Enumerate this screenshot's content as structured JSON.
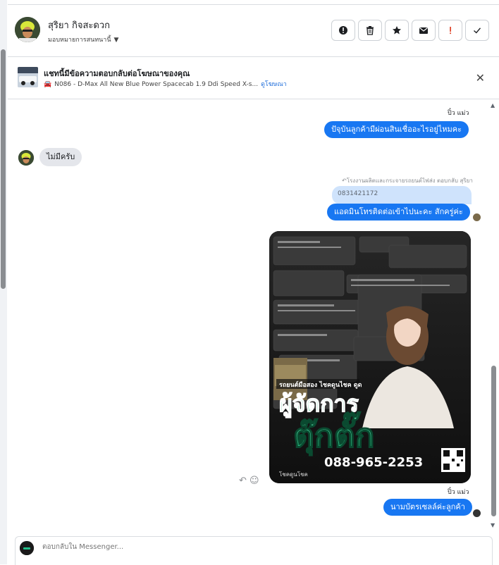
{
  "header": {
    "contact_name": "สุริยา กิจสะดวก",
    "assign_label": "มอบหมายการสนทนานี้",
    "action_icons": [
      "alert-circle-icon",
      "trash-icon",
      "star-icon",
      "envelope-icon",
      "exclamation-icon",
      "check-icon"
    ]
  },
  "ad_banner": {
    "title": "แชทนี้มีข้อความตอบกลับต่อโฆษณาของคุณ",
    "product": "N086 - D-Max All New Blue Power Spacecab 1.9 Ddi Speed X-s...",
    "view_ad_link": "ดูโฆษณา"
  },
  "messages": {
    "sender_1": "ปิ๋ว แม่ว",
    "msg_out_1": "ปัจุบันลูกค้ามีผ่อนสินเชื่ออะไรอยู่ไหมคะ",
    "msg_in_1": "ไม่มีครับ",
    "reply_note": "↶โรงงานผลิตและกระจายรถยนต์ไฟส่ง ตอบกลับ สุริยา",
    "reply_quote": "0831421172",
    "msg_out_2": "แอดมินโทรติดต่อเข้าไปนะคะ สักครู่ค่ะ",
    "sender_2": "ปิ๋ว แม่ว",
    "msg_out_3": "นามบัตรเซลล์ค่ะลูกค้า"
  },
  "image_card": {
    "headline_small": "รถยนต์มือสอง ไชคดูนไชค ดูด",
    "headline_big_1": "ผู้จัดการ",
    "headline_big_2": "ตุ๊กตั๊ก",
    "phone": "088-965-2253",
    "brand": "โชคดูนโชค"
  },
  "composer": {
    "placeholder": "ตอบกลับใน Messenger..."
  },
  "colors": {
    "accent": "#1877f2",
    "incoming_bubble": "#e4e6eb",
    "quote_bubble": "#cfe3fc",
    "banner_green": "#22c08a"
  }
}
